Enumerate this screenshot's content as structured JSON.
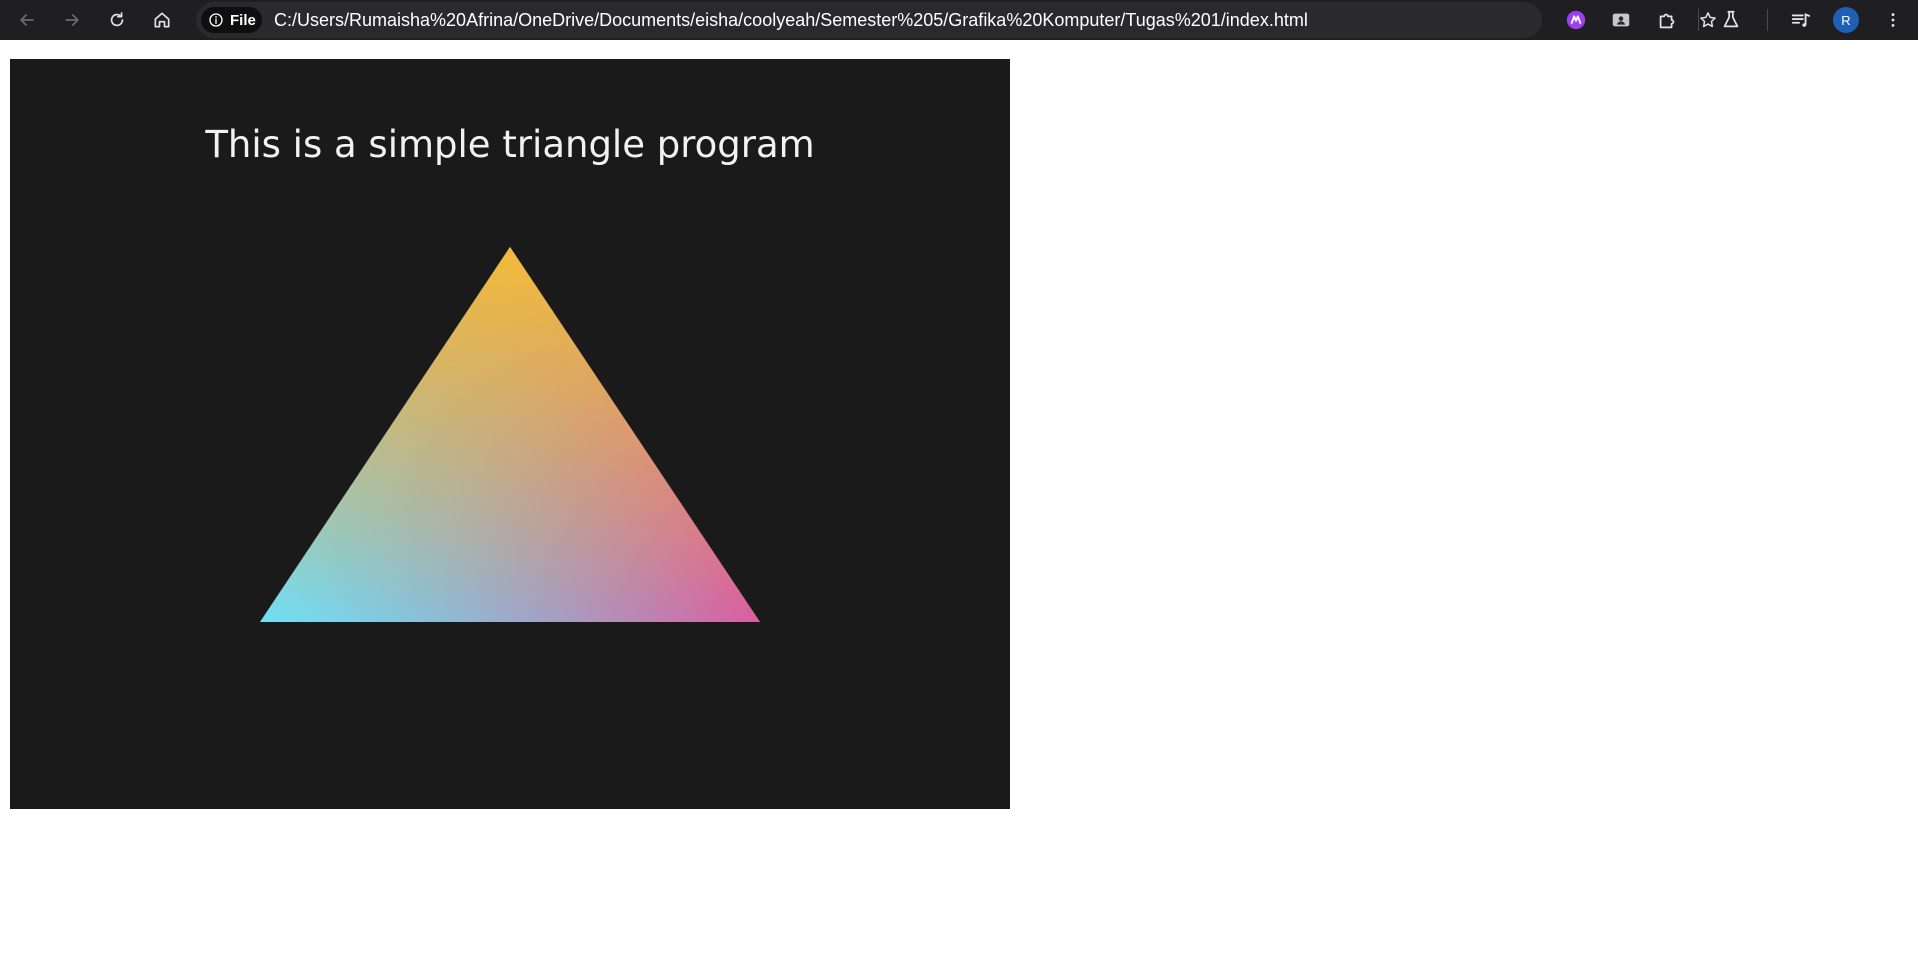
{
  "browser": {
    "site_chip_label": "File",
    "url": "C:/Users/Rumaisha%20Afrina/OneDrive/Documents/eisha/coolyeah/Semester%205/Grafika%20Komputer/Tugas%201/index.html",
    "profile_initial": "R",
    "icons": {
      "back": "arrow-left-icon",
      "forward": "arrow-right-icon",
      "reload": "reload-icon",
      "home": "home-icon",
      "site_info": "info-icon",
      "bookmark": "star-icon",
      "extension_1": "purple-extension-icon",
      "extension_2": "profile-card-extension-icon",
      "extensions_menu": "puzzle-icon",
      "labs": "flask-icon",
      "reading_list": "playlist-icon",
      "menu": "kebab-menu-icon"
    },
    "colors": {
      "toolbar": "#1f1f21",
      "omnibox": "#2a2a2c",
      "avatar": "#1f5fb5"
    }
  },
  "page": {
    "title": "This is a simple triangle program",
    "canvas_background": "#1a1a1a",
    "triangle": {
      "vertex_colors": {
        "top": "#f2bb3a",
        "bottom_left": "#6fe0f5",
        "bottom_right": "#ec4894"
      }
    }
  }
}
